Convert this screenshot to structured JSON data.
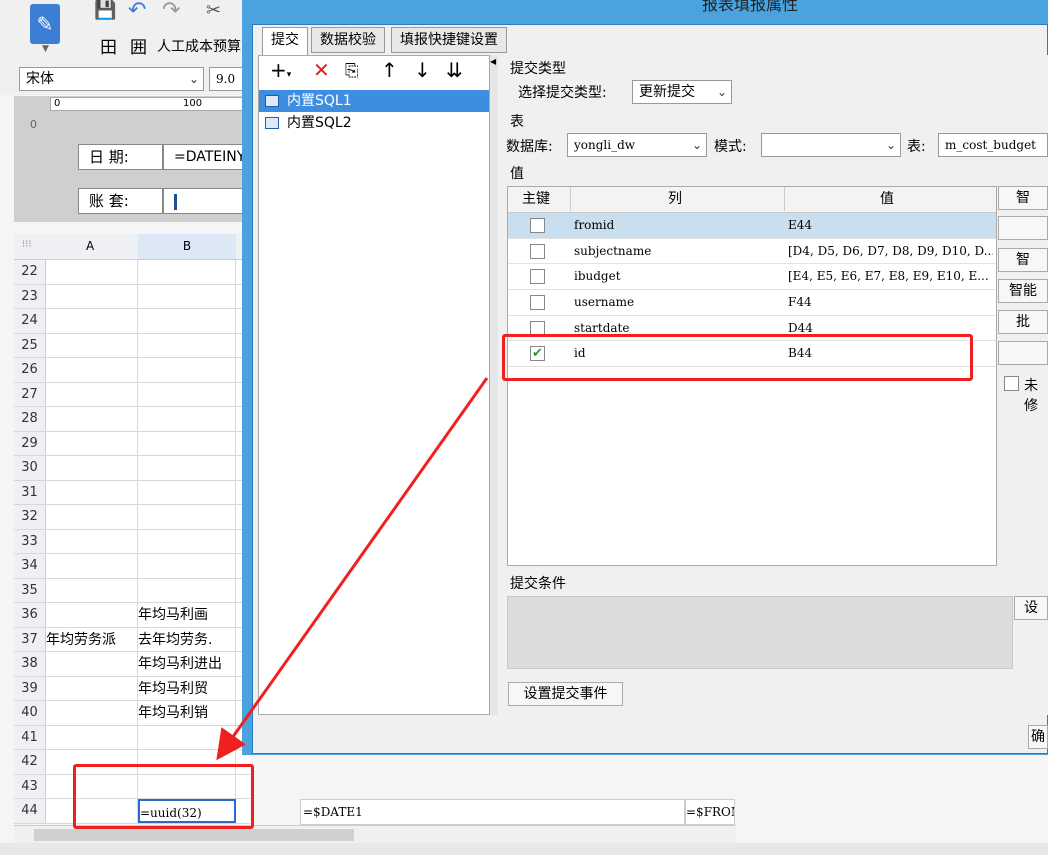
{
  "app": {
    "font_name": "宋体",
    "font_size": "9.0",
    "doc_title": "人工成本预算",
    "design_labels": {
      "date": "日 期:",
      "date_value": "=DATEINY",
      "account": "账 套:"
    },
    "ruler_marks": [
      "0",
      "100"
    ],
    "columns": [
      "A",
      "B"
    ],
    "rows": [
      {
        "n": "22",
        "a": "",
        "b": ""
      },
      {
        "n": "23",
        "a": "",
        "b": ""
      },
      {
        "n": "24",
        "a": "",
        "b": ""
      },
      {
        "n": "25",
        "a": "",
        "b": ""
      },
      {
        "n": "26",
        "a": "",
        "b": ""
      },
      {
        "n": "27",
        "a": "",
        "b": ""
      },
      {
        "n": "28",
        "a": "",
        "b": ""
      },
      {
        "n": "29",
        "a": "",
        "b": ""
      },
      {
        "n": "30",
        "a": "",
        "b": ""
      },
      {
        "n": "31",
        "a": "",
        "b": ""
      },
      {
        "n": "32",
        "a": "",
        "b": ""
      },
      {
        "n": "33",
        "a": "",
        "b": ""
      },
      {
        "n": "34",
        "a": "",
        "b": ""
      },
      {
        "n": "35",
        "a": "",
        "b": ""
      },
      {
        "n": "36",
        "a": "",
        "b": "年均马利画"
      },
      {
        "n": "37",
        "a": "年均劳务派",
        "b": "去年均劳务."
      },
      {
        "n": "38",
        "a": "",
        "b": "年均马利进出"
      },
      {
        "n": "39",
        "a": "",
        "b": "年均马利贸"
      },
      {
        "n": "40",
        "a": "",
        "b": "年均马利销"
      },
      {
        "n": "41",
        "a": "",
        "b": ""
      },
      {
        "n": "42",
        "a": "",
        "b": ""
      },
      {
        "n": "43",
        "a": "",
        "b": ""
      },
      {
        "n": "44",
        "a": "",
        "b": "=uuid(32)"
      }
    ],
    "extra_cells": {
      "c44": "=$DATE1",
      "d44": "=$FROM"
    }
  },
  "dialog": {
    "title": "报表填报属性",
    "tabs": [
      "提交",
      "数据校验",
      "填报快捷键设置"
    ],
    "sql_list": [
      "内置SQL1",
      "内置SQL2"
    ],
    "submit_type_section": "提交类型",
    "submit_type_label": "选择提交类型:",
    "submit_type_value": "更新提交",
    "table_section": "表",
    "db_label": "数据库:",
    "db_value": "yongli_dw",
    "schema_label": "模式:",
    "schema_value": "",
    "table_label": "表:",
    "table_value": "m_cost_budget",
    "value_section": "值",
    "headers": [
      "主键",
      "列",
      "值"
    ],
    "rows": [
      {
        "key": false,
        "col": "fromid",
        "val": "E44"
      },
      {
        "key": false,
        "col": "subjectname",
        "val": "[D4, D5, D6, D7, D8, D9, D10, D..."
      },
      {
        "key": false,
        "col": "ibudget",
        "val": "[E4, E5, E6, E7, E8, E9, E10, E..."
      },
      {
        "key": false,
        "col": "username",
        "val": "F44"
      },
      {
        "key": false,
        "col": "startdate",
        "val": "D44"
      },
      {
        "key": true,
        "col": "id",
        "val": "B44"
      }
    ],
    "side_buttons": [
      "智",
      "",
      "智",
      "智能",
      "批",
      ""
    ],
    "unmodified_label": "未修",
    "condition_section": "提交条件",
    "condition_btn": "设",
    "event_btn": "设置提交事件",
    "ok_btn": "确"
  },
  "colors": {
    "dialog_frame": "#4aa3df",
    "selection": "#3d8ee0",
    "annotation": "#f02020"
  }
}
